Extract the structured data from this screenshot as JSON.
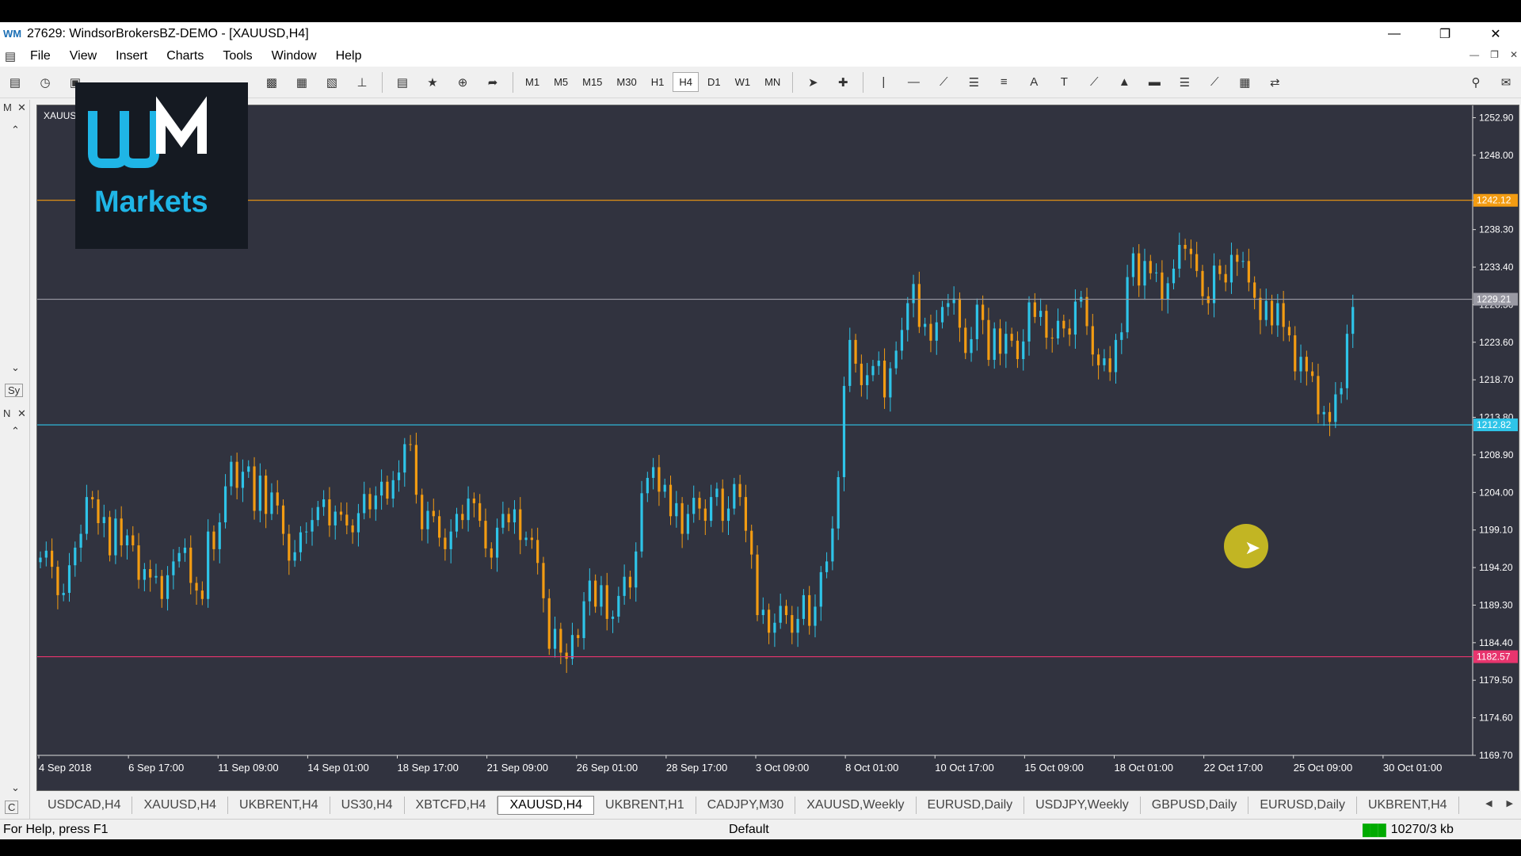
{
  "window": {
    "app_icon": "wm-logo-icon",
    "title": "27629: WindsorBrokersBZ-DEMO - [XAUUSD,H4]",
    "controls": [
      "minimize-icon",
      "restore-icon",
      "close-icon"
    ]
  },
  "menu": {
    "items": [
      "File",
      "View",
      "Insert",
      "Charts",
      "Tools",
      "Window",
      "Help"
    ]
  },
  "toolbar": {
    "timeframes": [
      "M1",
      "M5",
      "M15",
      "M30",
      "H1",
      "H4",
      "D1",
      "W1",
      "MN"
    ],
    "active_timeframe": "H4"
  },
  "left_panel": {
    "market_watch_label": "M",
    "symbols_tab": "Sy",
    "navigator_label": "N",
    "common_tab": "C"
  },
  "watermark": {
    "brand_mark": "WM",
    "brand_text": "Markets"
  },
  "chart_data": {
    "type": "candlestick",
    "symbol_label": "XAUUSD,H4",
    "y_ticks": [
      "1252.90",
      "1248.00",
      "1242.10",
      "1238.30",
      "1233.40",
      "1228.50",
      "1223.60",
      "1218.70",
      "1213.80",
      "1208.90",
      "1204.00",
      "1199.10",
      "1194.20",
      "1189.30",
      "1184.40",
      "1179.50",
      "1174.60",
      "1169.70"
    ],
    "ylim": [
      1169.7,
      1254.5
    ],
    "x_ticks": [
      "4 Sep 2018",
      "6 Sep 17:00",
      "11 Sep 09:00",
      "14 Sep 01:00",
      "18 Sep 17:00",
      "21 Sep 09:00",
      "26 Sep 01:00",
      "28 Sep 17:00",
      "3 Oct 09:00",
      "8 Oct 01:00",
      "10 Oct 17:00",
      "15 Oct 09:00",
      "18 Oct 01:00",
      "22 Oct 17:00",
      "25 Oct 09:00",
      "30 Oct 01:00"
    ],
    "horizontal_lines": [
      {
        "price": 1242.12,
        "label": "1242.12",
        "color": "#f39c12"
      },
      {
        "price": 1229.21,
        "label": "1229.21",
        "color": "#9a9aa4"
      },
      {
        "price": 1212.82,
        "label": "1212.82",
        "color": "#2ec4e8"
      },
      {
        "price": 1182.57,
        "label": "1182.57",
        "color": "#e8356e"
      }
    ],
    "colors": {
      "bull": "#2ec4e8",
      "bear": "#f39c12",
      "background": "#31333f"
    },
    "closes": [
      1195.5,
      1196.4,
      1194.3,
      1190.6,
      1190.9,
      1194.5,
      1196.8,
      1198.6,
      1203.4,
      1203.1,
      1200.0,
      1200.8,
      1195.8,
      1200.6,
      1197.1,
      1198.4,
      1197.1,
      1192.6,
      1194.0,
      1192.9,
      1193.1,
      1190.1,
      1193.2,
      1195.0,
      1196.1,
      1196.8,
      1192.2,
      1191.2,
      1190.1,
      1198.9,
      1196.6,
      1200.1,
      1204.8,
      1208.0,
      1204.6,
      1206.7,
      1207.4,
      1201.6,
      1206.2,
      1201.2,
      1204.0,
      1202.3,
      1198.6,
      1195.1,
      1196.2,
      1198.8,
      1198.9,
      1200.4,
      1202.1,
      1203.1,
      1199.7,
      1201.5,
      1201.1,
      1199.7,
      1198.8,
      1201.3,
      1203.8,
      1201.8,
      1203.6,
      1205.4,
      1203.2,
      1205.6,
      1206.6,
      1210.3,
      1210.2,
      1203.7,
      1199.2,
      1201.6,
      1200.9,
      1198.1,
      1196.6,
      1198.9,
      1201.2,
      1200.4,
      1203.2,
      1202.6,
      1200.3,
      1196.7,
      1195.5,
      1199.4,
      1201.2,
      1200.1,
      1201.8,
      1197.8,
      1198.1,
      1197.8,
      1194.8,
      1190.2,
      1183.6,
      1186.2,
      1183.1,
      1182.3,
      1185.4,
      1185.0,
      1189.8,
      1192.5,
      1189.1,
      1191.9,
      1187.5,
      1187.8,
      1190.5,
      1193.0,
      1191.6,
      1196.3,
      1203.9,
      1205.9,
      1207.3,
      1204.1,
      1205.0,
      1200.9,
      1202.6,
      1198.6,
      1201.2,
      1203.3,
      1201.9,
      1200.3,
      1203.4,
      1204.5,
      1200.3,
      1201.9,
      1205.1,
      1203.4,
      1199.0,
      1195.9,
      1188.0,
      1188.7,
      1185.7,
      1187.0,
      1189.2,
      1188.0,
      1185.7,
      1187.5,
      1190.6,
      1186.6,
      1189.1,
      1193.6,
      1195.0,
      1199.3,
      1206.0,
      1217.9,
      1223.9,
      1220.8,
      1218.0,
      1219.3,
      1220.5,
      1221.2,
      1216.4,
      1220.2,
      1222.5,
      1225.2,
      1228.7,
      1231.2,
      1225.6,
      1226.0,
      1223.8,
      1226.2,
      1228.2,
      1228.7,
      1229.3,
      1225.5,
      1222.2,
      1224.0,
      1228.5,
      1226.5,
      1221.3,
      1225.4,
      1222.1,
      1224.7,
      1223.8,
      1221.4,
      1223.7,
      1228.8,
      1226.9,
      1227.7,
      1224.2,
      1224.1,
      1226.4,
      1225.4,
      1224.6,
      1228.9,
      1229.5,
      1225.7,
      1222.0,
      1220.6,
      1221.5,
      1219.7,
      1223.9,
      1224.9,
      1232.1,
      1235.2,
      1231.0,
      1234.2,
      1232.6,
      1232.7,
      1229.2,
      1231.3,
      1233.2,
      1236.3,
      1235.8,
      1235.1,
      1232.9,
      1229.6,
      1228.7,
      1233.6,
      1232.5,
      1231.4,
      1235.0,
      1234.1,
      1234.2,
      1231.4,
      1229.4,
      1226.5,
      1229.0,
      1225.8,
      1228.7,
      1225.6,
      1224.5,
      1219.8,
      1221.7,
      1219.8,
      1219.2,
      1214.2,
      1214.5,
      1213.2,
      1216.8,
      1217.6,
      1224.7,
      1228.2
    ]
  },
  "symbol_tabs": {
    "items": [
      "USDCAD,H4",
      "XAUUSD,H4",
      "UKBRENT,H4",
      "US30,H4",
      "XBTCFD,H4",
      "XAUUSD,H4",
      "UKBRENT,H1",
      "CADJPY,M30",
      "XAUUSD,Weekly",
      "EURUSD,Daily",
      "USDJPY,Weekly",
      "GBPUSD,Daily",
      "EURUSD,Daily",
      "UKBRENT,H4"
    ],
    "active_index": 5
  },
  "status": {
    "help_text": "For Help, press F1",
    "profile": "Default",
    "connection": "10270/3 kb"
  }
}
